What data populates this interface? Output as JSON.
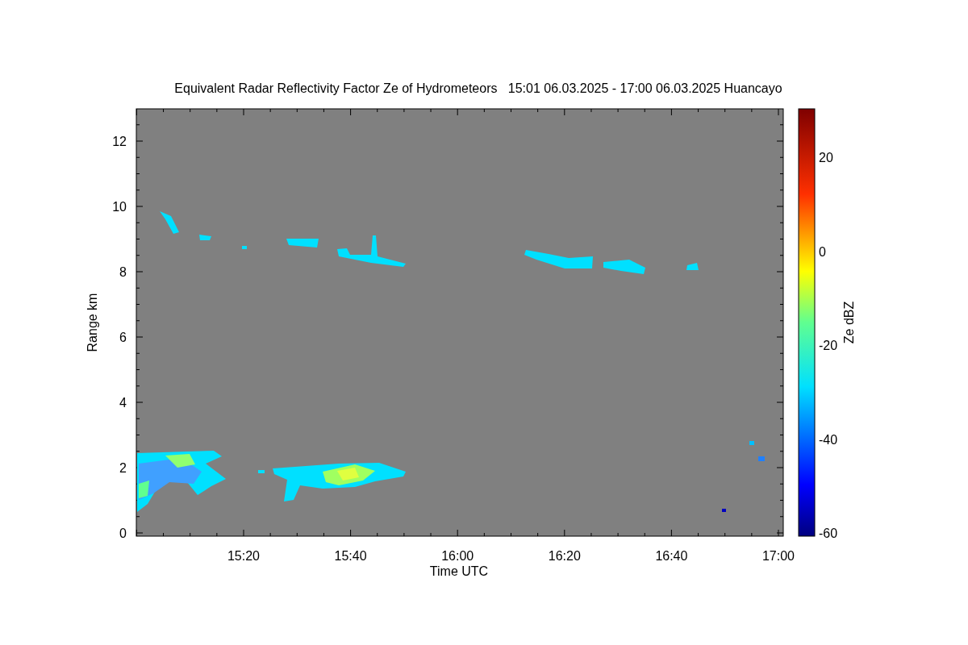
{
  "title": "Equivalent Radar Reflectivity Factor Ze of Hydrometeors   15:01 06.03.2025 - 17:00 06.03.2025 Huancayo",
  "x_axis": {
    "label": "Time UTC",
    "ticks": [
      "15:20",
      "15:40",
      "16:00",
      "16:20",
      "16:40",
      "17:00"
    ]
  },
  "y_axis": {
    "label": "Range km",
    "ticks": [
      "12",
      "10",
      "8",
      "6",
      "4",
      "2",
      "0"
    ]
  },
  "colorbar": {
    "label": "Ze dBZ",
    "ticks": [
      "20",
      "0",
      "-20",
      "-40",
      "-60"
    ]
  }
}
